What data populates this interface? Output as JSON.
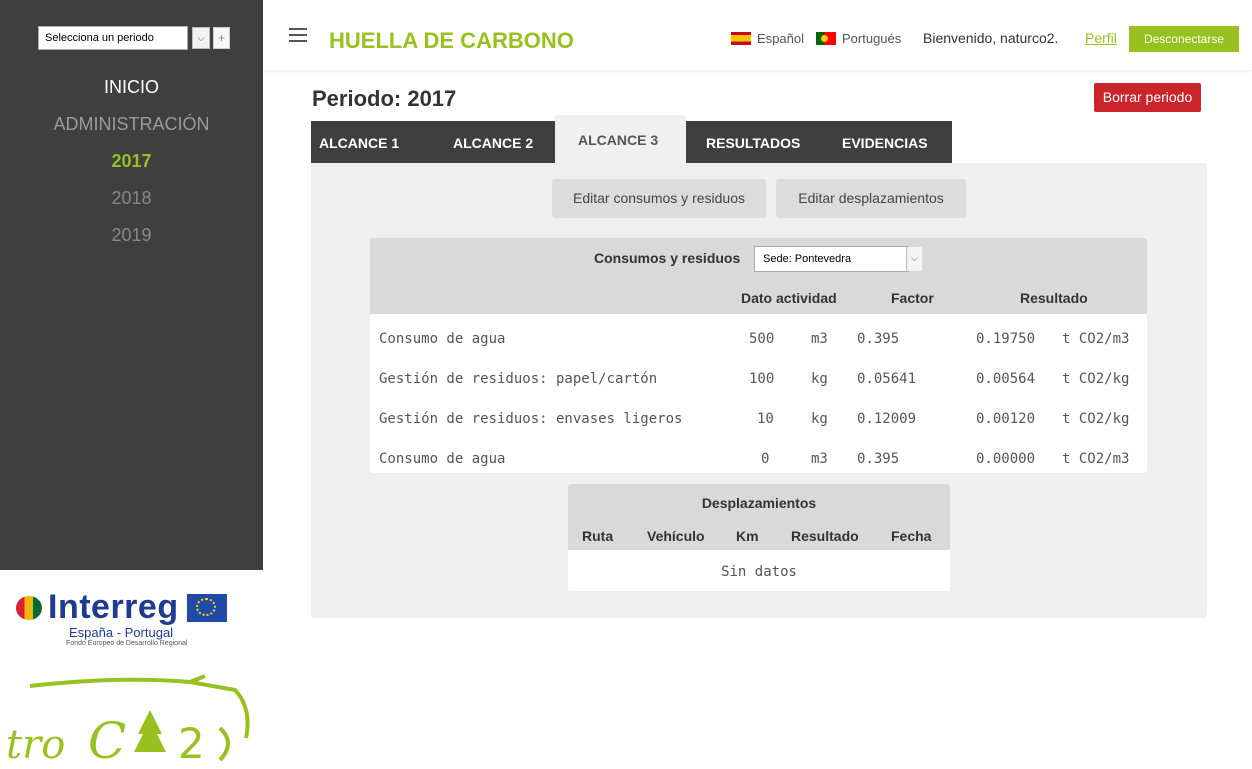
{
  "sidebar": {
    "period_select": "Selecciona un periodo",
    "add_symbol": "+",
    "nav": {
      "inicio": "INICIO",
      "administracion": "ADMINISTRACIÓN",
      "y2017": "2017",
      "y2018": "2018",
      "y2019": "2019"
    },
    "interreg": {
      "brand": "Interreg",
      "country": "España - Portugal",
      "fund": "Fondo Europeo de Desarrollo Regional"
    },
    "troco2_logo": "troCO2"
  },
  "header": {
    "title": "HUELLA DE CARBONO",
    "lang_es": "Español",
    "lang_pt": "Portugués",
    "welcome": "Bienvenido, naturco2.",
    "profile": "Perfil",
    "logout": "Desconectarse"
  },
  "main": {
    "period_title": "Periodo: 2017",
    "delete_button": "Borrar periodo",
    "tabs": [
      "ALCANCE 1",
      "ALCANCE 2",
      "ALCANCE 3",
      "RESULTADOS",
      "EVIDENCIAS"
    ],
    "active_tab": "ALCANCE 3",
    "edit_consumos": "Editar consumos y residuos",
    "edit_desplazamientos": "Editar desplazamientos",
    "consumos": {
      "title": "Consumos y residuos",
      "sede": "Sede: Pontevedra",
      "columns": [
        "Dato actividad",
        "Factor",
        "Resultado"
      ],
      "rows": [
        {
          "name": "Consumo de agua",
          "value": "500",
          "unit": "m3",
          "factor": "0.395",
          "result": "0.19750",
          "result_unit": "t CO2/m3"
        },
        {
          "name": "Gestión de residuos: papel/cartón",
          "value": "100",
          "unit": "kg",
          "factor": "0.05641",
          "result": "0.00564",
          "result_unit": "t CO2/kg"
        },
        {
          "name": "Gestión de residuos: envases ligeros",
          "value": "10",
          "unit": "kg",
          "factor": "0.12009",
          "result": "0.00120",
          "result_unit": "t CO2/kg"
        },
        {
          "name": "Consumo de agua",
          "value": "0",
          "unit": "m3",
          "factor": "0.395",
          "result": "0.00000",
          "result_unit": "t CO2/m3"
        }
      ]
    },
    "desplazamientos": {
      "title": "Desplazamientos",
      "columns": [
        "Ruta",
        "Vehículo",
        "Km",
        "Resultado",
        "Fecha"
      ],
      "empty": "Sin datos"
    }
  },
  "colors": {
    "accent_green": "#97c11f",
    "sidebar_dark": "#3f3f3f",
    "danger_red": "#c9252a"
  }
}
